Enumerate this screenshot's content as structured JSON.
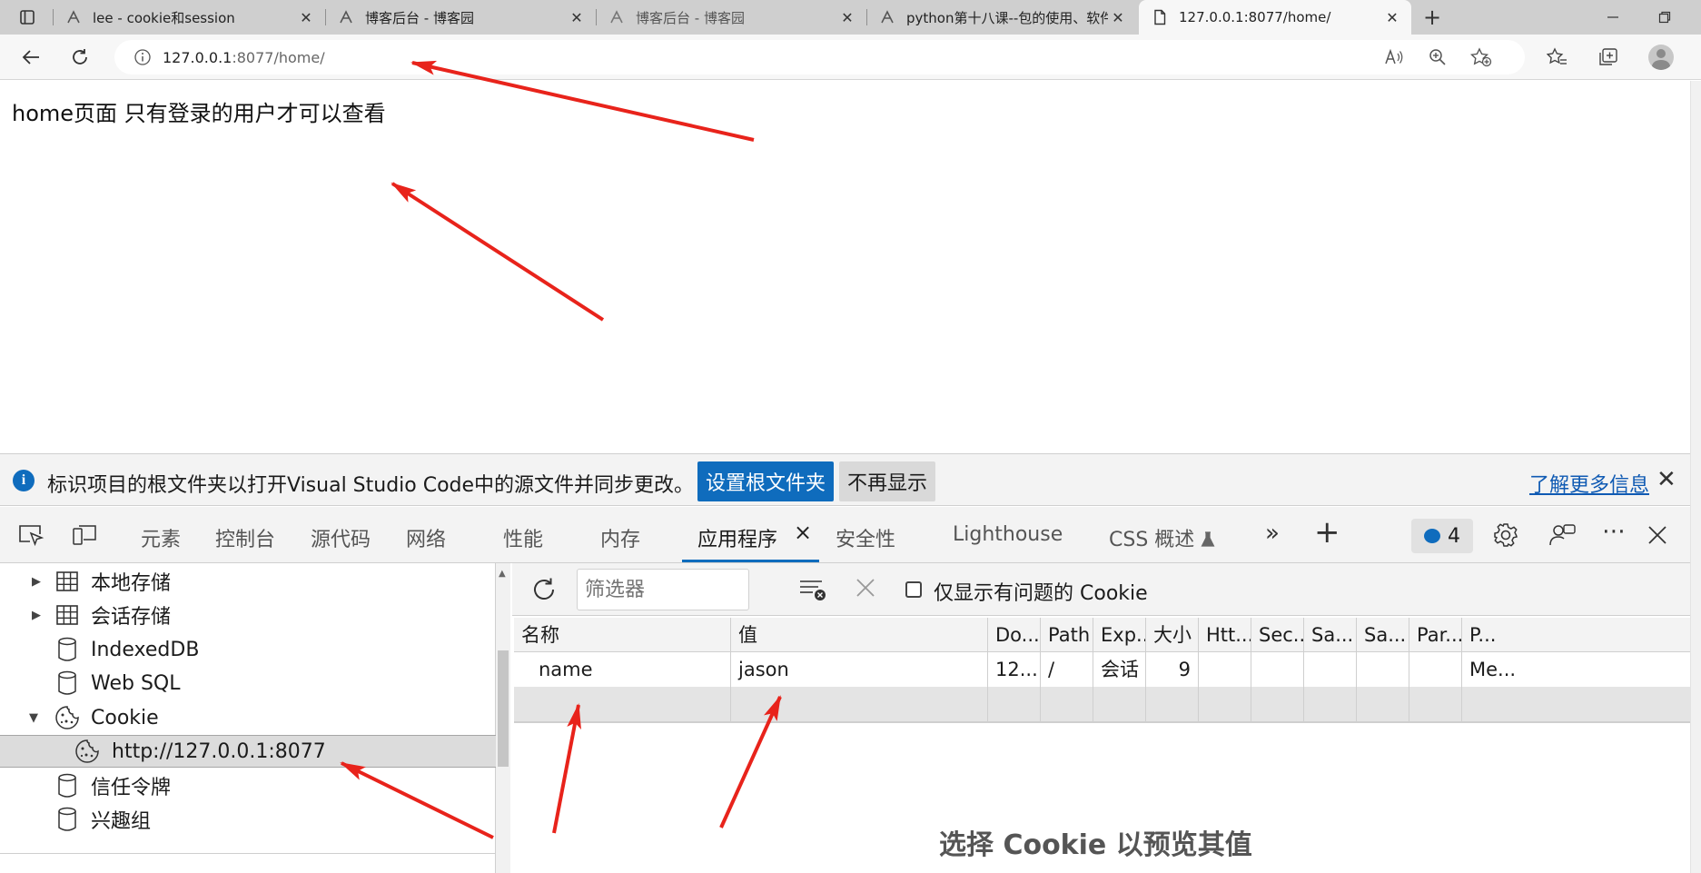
{
  "browser": {
    "tabs": [
      {
        "title": "lee - cookie和session",
        "active": false
      },
      {
        "title": "博客后台 - 博客园",
        "active": false
      },
      {
        "title": "博客后台 - 博客园",
        "active": false
      },
      {
        "title": "python第十八课--包的使用、软件",
        "active": false
      },
      {
        "title": "127.0.0.1:8077/home/",
        "active": true
      }
    ],
    "close_glyph": "✕",
    "new_tab_glyph": "+",
    "address": {
      "host": "127.0.0.1",
      "path": ":8077/home/"
    }
  },
  "page": {
    "text": "home页面 只有登录的用户才可以查看"
  },
  "devtools": {
    "infobar": {
      "message": "标识项目的根文件夹以打开Visual Studio Code中的源文件并同步更改。",
      "primary_button": "设置根文件夹",
      "secondary_button": "不再显示",
      "learn_more": "了解更多信息",
      "close": "✕"
    },
    "tabs": [
      "元素",
      "控制台",
      "源代码",
      "网络",
      "性能",
      "内存",
      "应用程序",
      "安全性",
      "Lighthouse",
      "CSS 概述"
    ],
    "active_tab": "应用程序",
    "active_tab_close": "×",
    "issues_count": "4",
    "more_tabs": "»",
    "add_tab": "+",
    "tree": [
      {
        "label": "本地存储",
        "icon": "table-icon",
        "expand": "▶"
      },
      {
        "label": "会话存储",
        "icon": "table-icon",
        "expand": "▶"
      },
      {
        "label": "IndexedDB",
        "icon": "database-icon",
        "expand": ""
      },
      {
        "label": "Web SQL",
        "icon": "database-icon",
        "expand": ""
      },
      {
        "label": "Cookie",
        "icon": "cookie-icon",
        "expand": "▼"
      },
      {
        "label": "http://127.0.0.1:8077",
        "icon": "cookie-icon",
        "expand": "",
        "selected": true
      },
      {
        "label": "信任令牌",
        "icon": "database-icon",
        "expand": ""
      },
      {
        "label": "兴趣组",
        "icon": "database-icon",
        "expand": ""
      }
    ],
    "cookies": {
      "filter_placeholder": "筛选器",
      "only_issues_label": "仅显示有问题的 Cookie",
      "columns": [
        "名称",
        "值",
        "Do...",
        "Path",
        "Exp...",
        "大小",
        "Htt...",
        "Sec...",
        "Sa...",
        "Sa...",
        "Par...",
        "P..."
      ],
      "rows": [
        [
          "name",
          "jason",
          "12...",
          "/",
          "会话",
          "9",
          "",
          "",
          "",
          "",
          "",
          "Me..."
        ]
      ],
      "preview_hint": "选择 Cookie 以预览其值"
    }
  },
  "colors": {
    "accent": "#0f6cbd",
    "annotation": "#e8231b"
  }
}
